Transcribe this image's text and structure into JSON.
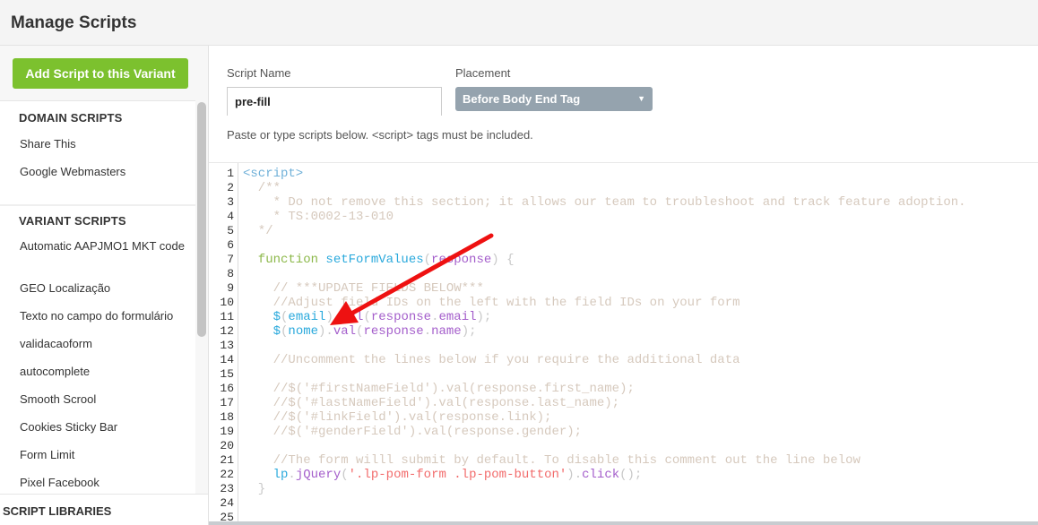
{
  "header": {
    "title": "Manage Scripts"
  },
  "sidebar": {
    "add_button": "Add Script to this Variant",
    "domain_header": "DOMAIN SCRIPTS",
    "domain_items": [
      "Share This",
      "Google Webmasters"
    ],
    "variant_header": "VARIANT SCRIPTS",
    "variant_items": [
      "Automatic AAPJMO1 MKT code",
      "GEO Localização",
      "Texto no campo do formulário",
      "validacaoform",
      "autocomplete",
      "Smooth Scrool",
      "Cookies Sticky Bar",
      "Form Limit",
      "Pixel Facebook"
    ],
    "libraries_header": "SCRIPT LIBRARIES"
  },
  "form": {
    "script_name_label": "Script Name",
    "script_name_value": "pre-fill",
    "placement_label": "Placement",
    "placement_value": "Before Body End Tag",
    "help_text": "Paste or type scripts below. <script> tags must be included."
  },
  "colors": {
    "accent_green": "#7cc12e",
    "select_bg": "#95a3ae",
    "annotation_arrow": "#ee1111"
  },
  "editor": {
    "line_numbers": [
      "1",
      "2",
      "3",
      "4",
      "5",
      "6",
      "7",
      "8",
      "9",
      "10",
      "11",
      "12",
      "13",
      "14",
      "15",
      "16",
      "17",
      "18",
      "19",
      "20",
      "21",
      "22",
      "23",
      "24",
      "25"
    ],
    "lines": [
      [
        [
          "tag",
          "<script>"
        ]
      ],
      [
        [
          "comment",
          "  /**"
        ]
      ],
      [
        [
          "comment",
          "    * Do not remove this section; it allows our team to troubleshoot and track feature adoption."
        ]
      ],
      [
        [
          "comment",
          "    * TS:0002-13-010"
        ]
      ],
      [
        [
          "comment",
          "  */"
        ]
      ],
      [],
      [
        [
          "kw",
          "  function "
        ],
        [
          "fn",
          "setFormValues"
        ],
        [
          "punc",
          "("
        ],
        [
          "prop",
          "response"
        ],
        [
          "punc",
          ") {"
        ]
      ],
      [],
      [
        [
          "comment",
          "    // ***UPDATE FIELDS BELOW***"
        ]
      ],
      [
        [
          "comment",
          "    //Adjust field IDs on the left with the field IDs on your form"
        ]
      ],
      [
        [
          "var",
          "    $"
        ],
        [
          "punc",
          "("
        ],
        [
          "var",
          "email"
        ],
        [
          "punc",
          ")."
        ],
        [
          "prop",
          "val"
        ],
        [
          "punc",
          "("
        ],
        [
          "prop",
          "response"
        ],
        [
          "punc",
          "."
        ],
        [
          "prop",
          "email"
        ],
        [
          "punc",
          ");"
        ]
      ],
      [
        [
          "var",
          "    $"
        ],
        [
          "punc",
          "("
        ],
        [
          "var",
          "nome"
        ],
        [
          "punc",
          ")."
        ],
        [
          "prop",
          "val"
        ],
        [
          "punc",
          "("
        ],
        [
          "prop",
          "response"
        ],
        [
          "punc",
          "."
        ],
        [
          "prop",
          "name"
        ],
        [
          "punc",
          ");"
        ]
      ],
      [],
      [
        [
          "comment",
          "    //Uncomment the lines below if you require the additional data"
        ]
      ],
      [],
      [
        [
          "comment",
          "    //$('#firstNameField').val(response.first_name);"
        ]
      ],
      [
        [
          "comment",
          "    //$('#lastNameField').val(response.last_name);"
        ]
      ],
      [
        [
          "comment",
          "    //$('#linkField').val(response.link);"
        ]
      ],
      [
        [
          "comment",
          "    //$('#genderField').val(response.gender);"
        ]
      ],
      [],
      [
        [
          "comment",
          "    //The form willl submit by default. To disable this comment out the line below"
        ]
      ],
      [
        [
          "var",
          "    lp"
        ],
        [
          "punc",
          "."
        ],
        [
          "prop",
          "jQuery"
        ],
        [
          "punc",
          "("
        ],
        [
          "str",
          "'.lp-pom-form .lp-pom-button'"
        ],
        [
          "punc",
          ")."
        ],
        [
          "prop",
          "click"
        ],
        [
          "punc",
          "();"
        ]
      ],
      [
        [
          "punc",
          "  }"
        ]
      ],
      [],
      []
    ]
  }
}
